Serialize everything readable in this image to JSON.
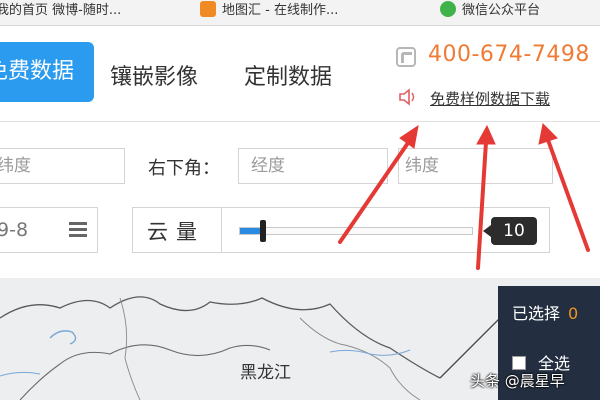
{
  "bookmarks": [
    {
      "label": "我的首页 微博-随时...",
      "icon": "page-icon"
    },
    {
      "label": "地图汇 - 在线制作...",
      "icon": "orange-site-icon"
    },
    {
      "label": "微信公众平台",
      "icon": "wechat-icon"
    }
  ],
  "nav": {
    "tabs": [
      {
        "label": "免费数据",
        "active": true
      },
      {
        "label": "镶嵌影像",
        "active": false
      },
      {
        "label": "定制数据",
        "active": false
      }
    ],
    "phone": "400-674-7498",
    "download_link": "免费样例数据下载"
  },
  "filters": {
    "top_left_lat_placeholder": "纬度",
    "bottom_right_label": "右下角：",
    "bottom_right_lng_placeholder": "经度",
    "bottom_right_lat_placeholder": "纬度",
    "date_value": "9-8",
    "cloud_label": "云量",
    "cloud_value": "10",
    "cloud_fraction": 0.1
  },
  "map": {
    "region_label": "黑龙江",
    "selected_label": "已选择",
    "selected_count": "0",
    "select_all_label": "全选",
    "watermark": "头条 @晨星早"
  },
  "colors": {
    "accent_blue": "#2a9bef",
    "phone_orange": "#ef7b35",
    "arrow_red": "#e53935",
    "panel_dark": "#232f40"
  }
}
